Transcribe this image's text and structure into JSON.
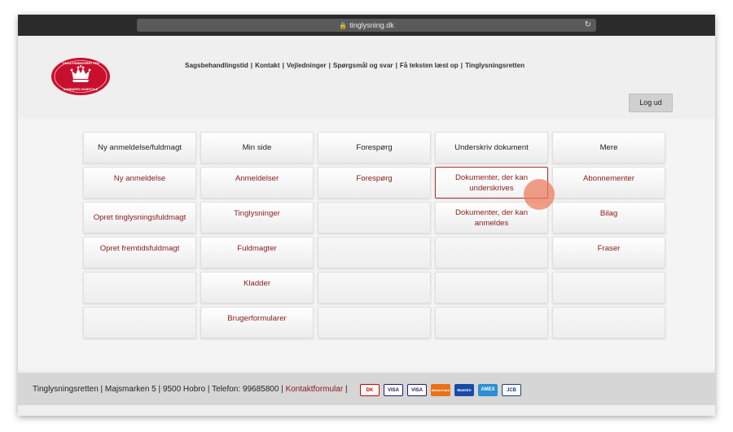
{
  "browser": {
    "url": "tinglysning.dk",
    "lock_icon": "lock-icon",
    "reload_icon": "reload-icon"
  },
  "logo": {
    "top_text": "TINGLYSNINGSRETTEN",
    "bottom_text": "DANMARKS DOMSTOLE",
    "color": "#c8102e"
  },
  "topnav": {
    "items": [
      "Sagsbehandlingstid",
      "Kontakt",
      "Vejledninger",
      "Spørgsmål og svar",
      "Få teksten læst op",
      "Tinglysningsretten"
    ],
    "separator": "|"
  },
  "logout_label": "Log ud",
  "menu": {
    "columns": [
      {
        "header": "Ny anmeldelse/fuldmagt",
        "items": [
          "Ny anmeldelse",
          "Opret tinglysningsfuldmagt",
          "Opret fremtidsfuldmagt"
        ]
      },
      {
        "header": "Min side",
        "items": [
          "Anmeldelser",
          "Tinglysninger",
          "Fuldmagter",
          "Kladder",
          "Brugerformularer"
        ]
      },
      {
        "header": "Forespørg",
        "items": [
          "Forespørg"
        ]
      },
      {
        "header": "Underskriv dokument",
        "items": [
          "Dokumenter, der kan underskrives",
          "Dokumenter, der kan anmeldes"
        ]
      },
      {
        "header": "Mere",
        "items": [
          "Abonnementer",
          "Bilag",
          "Fraser"
        ]
      }
    ],
    "selected": "Dokumenter, der kan underskrives",
    "link_color": "#8b1a1a"
  },
  "footer": {
    "text": "Tinglysningsretten | Majsmarken 5 | 9500 Hobro | Telefon: 99685800 |",
    "contact_link": "Kontaktformular",
    "after": "|",
    "cards": [
      "DK",
      "VISA",
      "VISA",
      "MasterCard",
      "Maestro",
      "AMEX",
      "JCB"
    ]
  }
}
